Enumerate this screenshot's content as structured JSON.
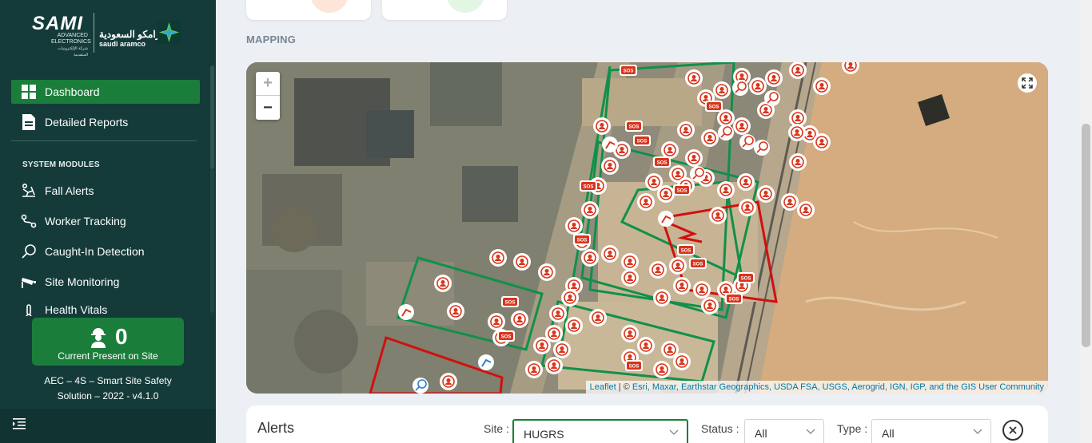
{
  "brand": {
    "sami": "SAMI",
    "sami_sub_1": "ADVANCED",
    "sami_sub_2": "ELECTRONICS",
    "sami_sub_ar": "شركة الإلكترونيات المتقدمة",
    "aramco_ar": "أرامكو السعودية",
    "aramco_en": "saudi aramco"
  },
  "nav": {
    "dashboard": "Dashboard",
    "detailed_reports": "Detailed Reports",
    "section_title": "SYSTEM MODULES",
    "modules": [
      "Fall Alerts",
      "Worker Tracking",
      "Caught-In Detection",
      "Site Monitoring",
      "Health Vitals"
    ]
  },
  "presence": {
    "count": "0",
    "label": "Current Present on Site"
  },
  "footer": {
    "line1": "AEC – 4S – Smart Site Safety",
    "line2": "Solution – 2022 - v4.1.0"
  },
  "main": {
    "mapping_label": "MAPPING",
    "map": {
      "zoom_in": "+",
      "zoom_out": "−",
      "attribution_leaflet": "Leaflet",
      "attribution_sep": " | © ",
      "attribution_sources": "Esri, Maxar, Earthstar Geographics, USDA FSA, USGS, Aerogrid, IGN, IGP, and the GIS User Community",
      "marker_sos": "SOS"
    },
    "alerts": {
      "title": "Alerts",
      "site_label": "Site :",
      "site_value": "HUGRS",
      "status_label": "Status :",
      "status_value": "All",
      "type_label": "Type :",
      "type_value": "All"
    }
  },
  "colors": {
    "sidebar_bg": "#143b3a",
    "accent_green": "#1a7e3a",
    "alert_red": "#d9341b",
    "zone_green": "#10904a",
    "zone_red": "#d01010"
  }
}
